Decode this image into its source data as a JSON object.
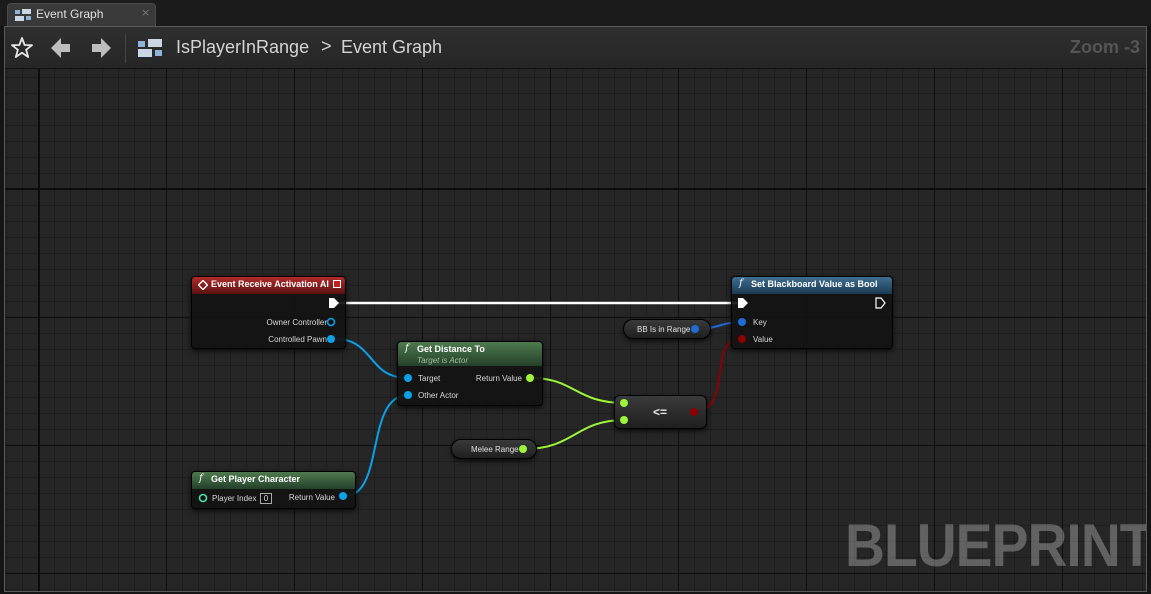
{
  "tab": {
    "label": "Event Graph",
    "close": "×",
    "icon": "event-graph-icon"
  },
  "toolbar": {
    "favorite_icon": "star-icon",
    "back_icon": "arrow-left-icon",
    "forward_icon": "arrow-right-icon",
    "breadcrumb": {
      "root": "IsPlayerInRange",
      "separator": ">",
      "current": "Event Graph"
    },
    "zoom": "Zoom -3"
  },
  "watermark": "BLUEPRINT",
  "colors": {
    "exec": "#ffffff",
    "object_pin": "#0aa1e8",
    "float_pin": "#9ef53a",
    "bool_pin": "#8c0000",
    "key_pin": "#1e6cd6"
  },
  "nodes": {
    "event_receive": {
      "title": "Event Receive Activation AI",
      "pins": {
        "owner_controller": "Owner Controller",
        "controlled_pawn": "Controlled Pawn"
      }
    },
    "set_blackboard": {
      "title": "Set Blackboard Value as Bool",
      "pins": {
        "key": "Key",
        "value": "Value"
      }
    },
    "get_distance": {
      "title": "Get Distance To",
      "subtitle": "Target is Actor",
      "pins": {
        "target": "Target",
        "other_actor": "Other Actor",
        "return_value": "Return Value"
      }
    },
    "get_player_character": {
      "title": "Get Player Character",
      "pins": {
        "player_index": "Player Index",
        "player_index_value": "0",
        "return_value": "Return Value"
      }
    },
    "bb_is_in_range": {
      "label": "BB Is in Range"
    },
    "melee_range": {
      "label": "Melee Range"
    },
    "compare": {
      "label": "<="
    }
  }
}
